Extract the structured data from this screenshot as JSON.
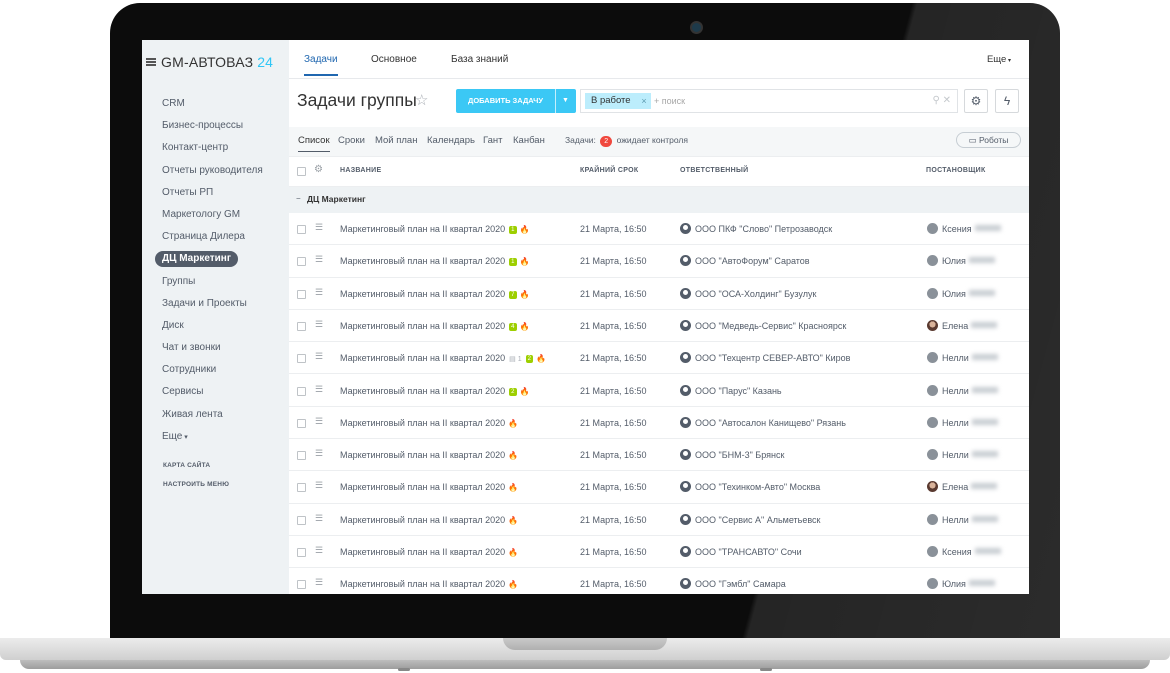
{
  "app": {
    "logo_text": "GM-АВТОВАЗ",
    "logo_suffix": "24"
  },
  "sidebar": {
    "items": [
      {
        "label": "CRM"
      },
      {
        "label": "Бизнес-процессы"
      },
      {
        "label": "Контакт-центр"
      },
      {
        "label": "Отчеты руководителя"
      },
      {
        "label": "Отчеты РП"
      },
      {
        "label": "Маркетологу GM"
      },
      {
        "label": "Страница Дилера"
      },
      {
        "label": "ДЦ Маркетинг",
        "active": true
      },
      {
        "label": "Группы"
      },
      {
        "label": "Задачи и Проекты"
      },
      {
        "label": "Диск"
      },
      {
        "label": "Чат и звонки"
      },
      {
        "label": "Сотрудники"
      },
      {
        "label": "Сервисы"
      },
      {
        "label": "Живая лента"
      },
      {
        "label": "Еще"
      }
    ],
    "site_map": "КАРТА САЙТА",
    "configure_menu": "НАСТРОИТЬ МЕНЮ"
  },
  "header": {
    "tabs": [
      {
        "label": "Задачи"
      },
      {
        "label": "Основное"
      },
      {
        "label": "База знаний"
      }
    ],
    "more": "Еще"
  },
  "toolbar": {
    "title": "Задачи группы",
    "add_button": "ДОБАВИТЬ ЗАДАЧУ",
    "filter_chip": "В работе",
    "search_placeholder": "+ поиск"
  },
  "views": {
    "tabs": [
      {
        "label": "Список"
      },
      {
        "label": "Сроки"
      },
      {
        "label": "Мой план"
      },
      {
        "label": "Календарь"
      },
      {
        "label": "Гант"
      },
      {
        "label": "Канбан"
      }
    ],
    "counter_prefix": "Задачи:",
    "counter_value": "2",
    "counter_suffix": "ожидает контроля",
    "robots": "Роботы"
  },
  "table": {
    "columns": {
      "name": "НАЗВАНИЕ",
      "deadline": "КРАЙНИЙ СРОК",
      "responsible": "ОТВЕТСТВЕННЫЙ",
      "creator": "ПОСТАНОВЩИК"
    },
    "group_name": "ДЦ Маркетинг",
    "rows": [
      {
        "name": "Маркетинговый план на II квартал 2020",
        "count": "1",
        "comments": "",
        "deadline": "21 Марта, 16:50",
        "responsible": "ООО ПКФ \"Слово\" Петрозаводск",
        "creator": "Ксения"
      },
      {
        "name": "Маркетинговый план на II квартал 2020",
        "count": "1",
        "comments": "",
        "deadline": "21 Марта, 16:50",
        "responsible": "ООО \"АвтоФорум\" Саратов",
        "creator": "Юлия"
      },
      {
        "name": "Маркетинговый план на II квартал 2020",
        "count": "7",
        "comments": "",
        "deadline": "21 Марта, 16:50",
        "responsible": "ООО \"ОСА-Холдинг\" Бузулук",
        "creator": "Юлия"
      },
      {
        "name": "Маркетинговый план на II квартал 2020",
        "count": "4",
        "comments": "",
        "deadline": "21 Марта, 16:50",
        "responsible": "ООО \"Медведь-Сервис\" Красноярск",
        "creator": "Елена"
      },
      {
        "name": "Маркетинговый план на II квартал 2020",
        "count": "2",
        "comments": "1",
        "deadline": "21 Марта, 16:50",
        "responsible": "ООО \"Техцентр СЕВЕР-АВТО\" Киров",
        "creator": "Нелли"
      },
      {
        "name": "Маркетинговый план на II квартал 2020",
        "count": "2",
        "comments": "",
        "deadline": "21 Марта, 16:50",
        "responsible": "ООО \"Парус\" Казань",
        "creator": "Нелли"
      },
      {
        "name": "Маркетинговый план на II квартал 2020",
        "count": "",
        "comments": "",
        "deadline": "21 Марта, 16:50",
        "responsible": "ООО \"Автосалон Канищево\" Рязань",
        "creator": "Нелли"
      },
      {
        "name": "Маркетинговый план на II квартал 2020",
        "count": "",
        "comments": "",
        "deadline": "21 Марта, 16:50",
        "responsible": "ООО \"БНМ-3\" Брянск",
        "creator": "Нелли"
      },
      {
        "name": "Маркетинговый план на II квартал 2020",
        "count": "",
        "comments": "",
        "deadline": "21 Марта, 16:50",
        "responsible": "ООО \"Техинком-Авто\" Москва",
        "creator": "Елена"
      },
      {
        "name": "Маркетинговый план на II квартал 2020",
        "count": "",
        "comments": "",
        "deadline": "21 Марта, 16:50",
        "responsible": "ООО \"Сервис А\" Альметьевск",
        "creator": "Нелли"
      },
      {
        "name": "Маркетинговый план на II квартал 2020",
        "count": "",
        "comments": "",
        "deadline": "21 Марта, 16:50",
        "responsible": "ООО \"ТРАНСАВТО\" Сочи",
        "creator": "Ксения"
      },
      {
        "name": "Маркетинговый план на II квартал 2020",
        "count": "",
        "comments": "",
        "deadline": "21 Марта, 16:50",
        "responsible": "ООО \"Гэмбл\" Самара",
        "creator": "Юлия"
      }
    ]
  },
  "colors": {
    "accent": "#2fc6f6",
    "button": "#3bc8f5",
    "badge": "#f0483e",
    "counter": "#9dcf00",
    "text": "#535c69"
  }
}
